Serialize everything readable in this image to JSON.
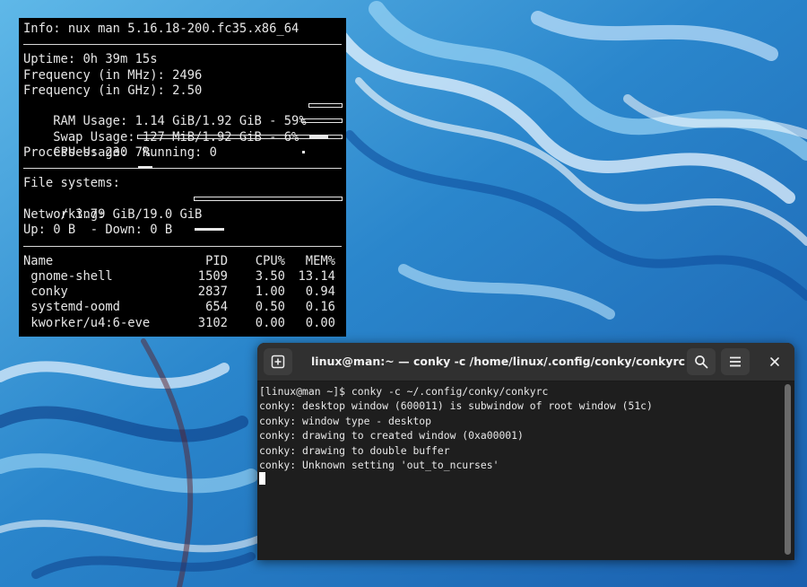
{
  "conky": {
    "info": "Info: nux man 5.16.18-200.fc35.x86_64",
    "uptime": "Uptime: 0h 39m 15s",
    "freq_mhz": "Frequency (in MHz): 2496",
    "freq_ghz": "Frequency (in GHz): 2.50",
    "ram": "RAM Usage: 1.14 GiB/1.92 GiB - 59%",
    "ram_fraction": 0.59,
    "swap": "Swap Usage: 127 MiB/1.92 GiB - 6%",
    "swap_fraction": 0.06,
    "cpu": "CPU Usage: 7%",
    "cpu_fraction": 0.07,
    "processes": "Processes: 230  Running: 0",
    "filesystems": "File systems:",
    "fs_root": " / 3.79 GiB/19.0 GiB",
    "fs_fraction": 0.2,
    "networking": "Networking:",
    "net": "Up: 0 B  - Down: 0 B",
    "proc_headers": [
      "Name",
      "PID",
      "CPU%",
      "MEM%"
    ],
    "proc_rows": [
      {
        "name": " gnome-shell",
        "pid": "1509",
        "cpu": "3.50",
        "mem": "13.14"
      },
      {
        "name": " conky",
        "pid": "2837",
        "cpu": "1.00",
        "mem": "0.94"
      },
      {
        "name": " systemd-oomd",
        "pid": "654",
        "cpu": "0.50",
        "mem": "0.16"
      },
      {
        "name": " kworker/u4:6-eve",
        "pid": "3102",
        "cpu": "0.00",
        "mem": "0.00"
      }
    ]
  },
  "terminal": {
    "title": "linux@man:~ — conky -c /home/linux/.config/conky/conkyrc",
    "new_tab_icon": "new-tab-icon",
    "search_icon": "search-icon",
    "menu_icon": "hamburger-menu-icon",
    "close_icon": "close-icon",
    "lines": [
      "[linux@man ~]$ conky -c ~/.config/conky/conkyrc",
      "conky: desktop window (600011) is subwindow of root window (51c)",
      "conky: window type - desktop",
      "conky: drawing to created window (0xa00001)",
      "conky: drawing to double buffer",
      "conky: Unknown setting 'out_to_ncurses'"
    ]
  }
}
